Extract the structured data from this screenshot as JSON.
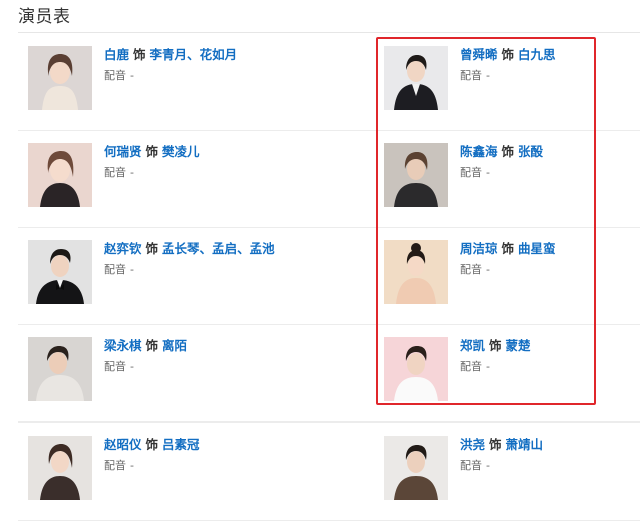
{
  "page": {
    "title": "演员表"
  },
  "labels": {
    "role_word": "饰",
    "voice_label": "配音",
    "voice_empty": "-",
    "role_separator": "、"
  },
  "cast": [
    {
      "actor": "白鹿",
      "roles": [
        "李青月",
        "花如月"
      ]
    },
    {
      "actor": "曾舜晞",
      "roles": [
        "白九思"
      ]
    },
    {
      "actor": "何瑞贤",
      "roles": [
        "樊凌儿"
      ]
    },
    {
      "actor": "陈鑫海",
      "roles": [
        "张酘"
      ]
    },
    {
      "actor": "赵弈钦",
      "roles": [
        "孟长琴",
        "孟启",
        "孟池"
      ]
    },
    {
      "actor": "周洁琼",
      "roles": [
        "曲星蛮"
      ]
    },
    {
      "actor": "梁永棋",
      "roles": [
        "离陌"
      ]
    },
    {
      "actor": "郑凯",
      "roles": [
        "蒙楚"
      ]
    },
    {
      "actor": "赵昭仪",
      "roles": [
        "吕素冠"
      ]
    },
    {
      "actor": "洪尧",
      "roles": [
        "萧靖山"
      ]
    }
  ],
  "colors": {
    "link": "#136ec2",
    "highlight": "#e0262b"
  }
}
